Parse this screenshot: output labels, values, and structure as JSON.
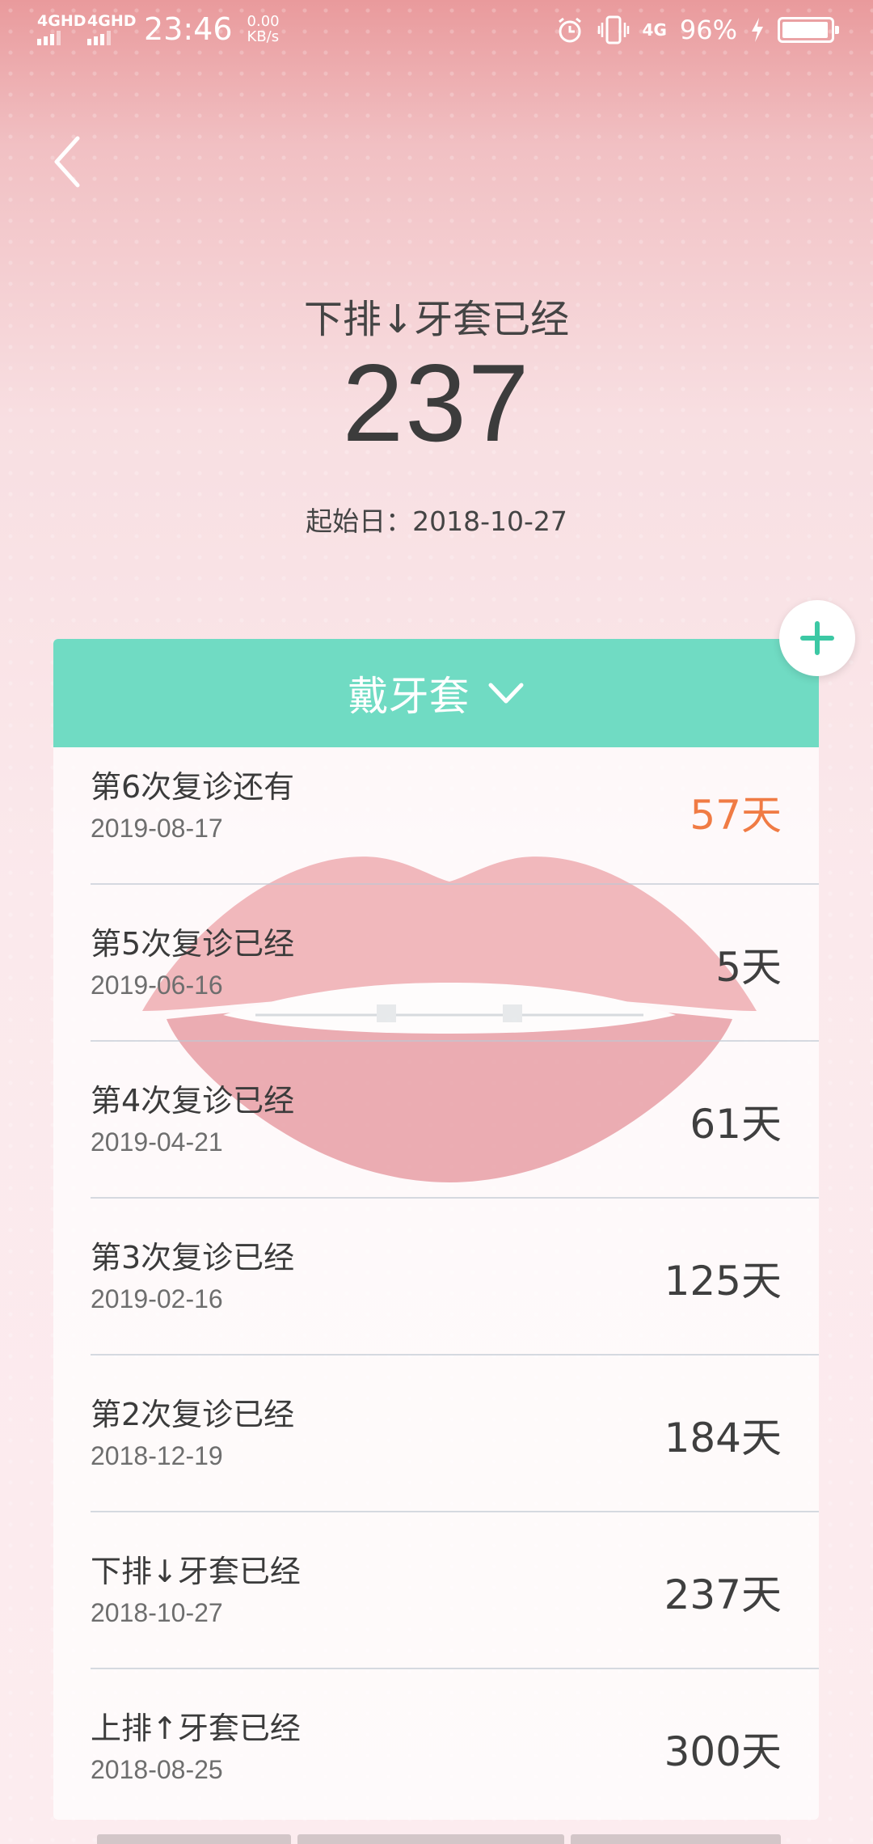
{
  "status_bar": {
    "net1": "4GHD",
    "net2": "4GHD",
    "time": "23:46",
    "speed_value": "0.00",
    "speed_unit": "KB/s",
    "net3": "4G",
    "battery_percent": "96%",
    "battery_level": 0.96
  },
  "header": {
    "title": "下排↓牙套已经",
    "count": "237",
    "start_date": "起始日：2018-10-27"
  },
  "card": {
    "header_label": "戴牙套",
    "accent_color": "#70dbc3",
    "highlight_color": "#f07b44",
    "rows": [
      {
        "title": "第6次复诊还有",
        "date": "2019-08-17",
        "days": "57天",
        "highlight": true
      },
      {
        "title": "第5次复诊已经",
        "date": "2019-06-16",
        "days": "5天",
        "highlight": false
      },
      {
        "title": "第4次复诊已经",
        "date": "2019-04-21",
        "days": "61天",
        "highlight": false
      },
      {
        "title": "第3次复诊已经",
        "date": "2019-02-16",
        "days": "125天",
        "highlight": false
      },
      {
        "title": "第2次复诊已经",
        "date": "2018-12-19",
        "days": "184天",
        "highlight": false
      },
      {
        "title": "下排↓牙套已经",
        "date": "2018-10-27",
        "days": "237天",
        "highlight": false
      },
      {
        "title": "上排↑牙套已经",
        "date": "2018-08-25",
        "days": "300天",
        "highlight": false
      }
    ]
  },
  "icons": {
    "back": "back-arrow-icon",
    "add": "plus-icon",
    "dropdown": "chevron-down-icon",
    "alarm": "alarm-icon",
    "vibrate": "vibrate-icon",
    "charging": "bolt-icon"
  }
}
